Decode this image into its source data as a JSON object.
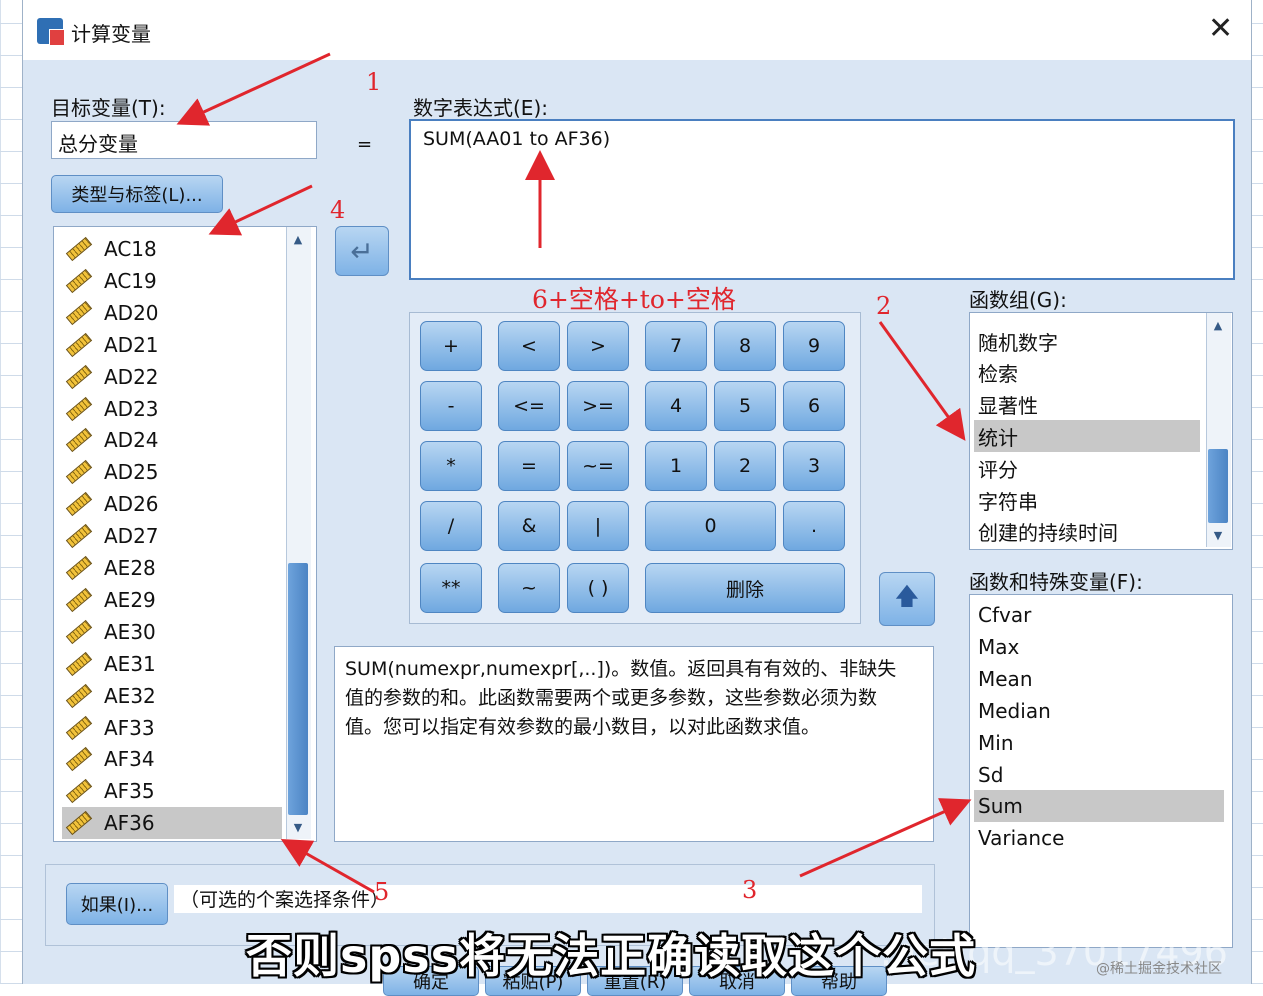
{
  "dialog": {
    "title": "计算变量",
    "target_label": "目标变量(T):",
    "target_value": "总分变量",
    "equals": "=",
    "expr_label": "数字表达式(E):",
    "expr_value": "SUM(AA01 to AF36)",
    "type_label_button": "类型与标签(L)...",
    "variables": [
      "AC18",
      "AC19",
      "AD20",
      "AD21",
      "AD22",
      "AD23",
      "AD24",
      "AD25",
      "AD26",
      "AD27",
      "AE28",
      "AE29",
      "AE30",
      "AE31",
      "AE32",
      "AF33",
      "AF34",
      "AF35",
      "AF36"
    ],
    "selected_variable": "AF36",
    "func_group_label": "函数组(G):",
    "func_groups": [
      "随机数字",
      "检索",
      "显著性",
      "统计",
      "评分",
      "字符串",
      "创建的持续时间"
    ],
    "selected_group": "统计",
    "func_label": "函数和特殊变量(F):",
    "functions": [
      "Cfvar",
      "Max",
      "Mean",
      "Median",
      "Min",
      "Sd",
      "Sum",
      "Variance"
    ],
    "selected_function": "Sum",
    "description": "SUM(numexpr,numexpr[,..])。数值。返回具有有效的、非缺失值的参数的和。此函数需要两个或更多参数，这些参数必须为数值。您可以指定有效参数的最小数目，以对此函数求值。",
    "if_button": "如果(I)...",
    "if_text": "（可选的个案选择条件）",
    "keypad": {
      "plus": "+",
      "lt": "<",
      "gt": ">",
      "k7": "7",
      "k8": "8",
      "k9": "9",
      "minus": "-",
      "le": "<=",
      "ge": ">=",
      "k4": "4",
      "k5": "5",
      "k6": "6",
      "mul": "*",
      "eq": "=",
      "ne": "~=",
      "k1": "1",
      "k2": "2",
      "k3": "3",
      "div": "/",
      "and": "&",
      "or": "|",
      "k0": "0",
      "dot": ".",
      "pow": "**",
      "not": "~",
      "paren": "( )",
      "del": "删除"
    },
    "bottom_buttons": [
      "确定",
      "粘贴(P)",
      "重置(R)",
      "取消",
      "帮助"
    ]
  },
  "annotations": {
    "n1": "1",
    "n2": "2",
    "n3": "3",
    "n4": "4",
    "n5": "5",
    "hint": "6+空格+to+空格"
  },
  "overlay": {
    "subtitle": "否则spss将无法正确读取这个公式",
    "watermark_url": ".net/qq_37017496",
    "watermark_site": "@稀土掘金技术社区"
  }
}
